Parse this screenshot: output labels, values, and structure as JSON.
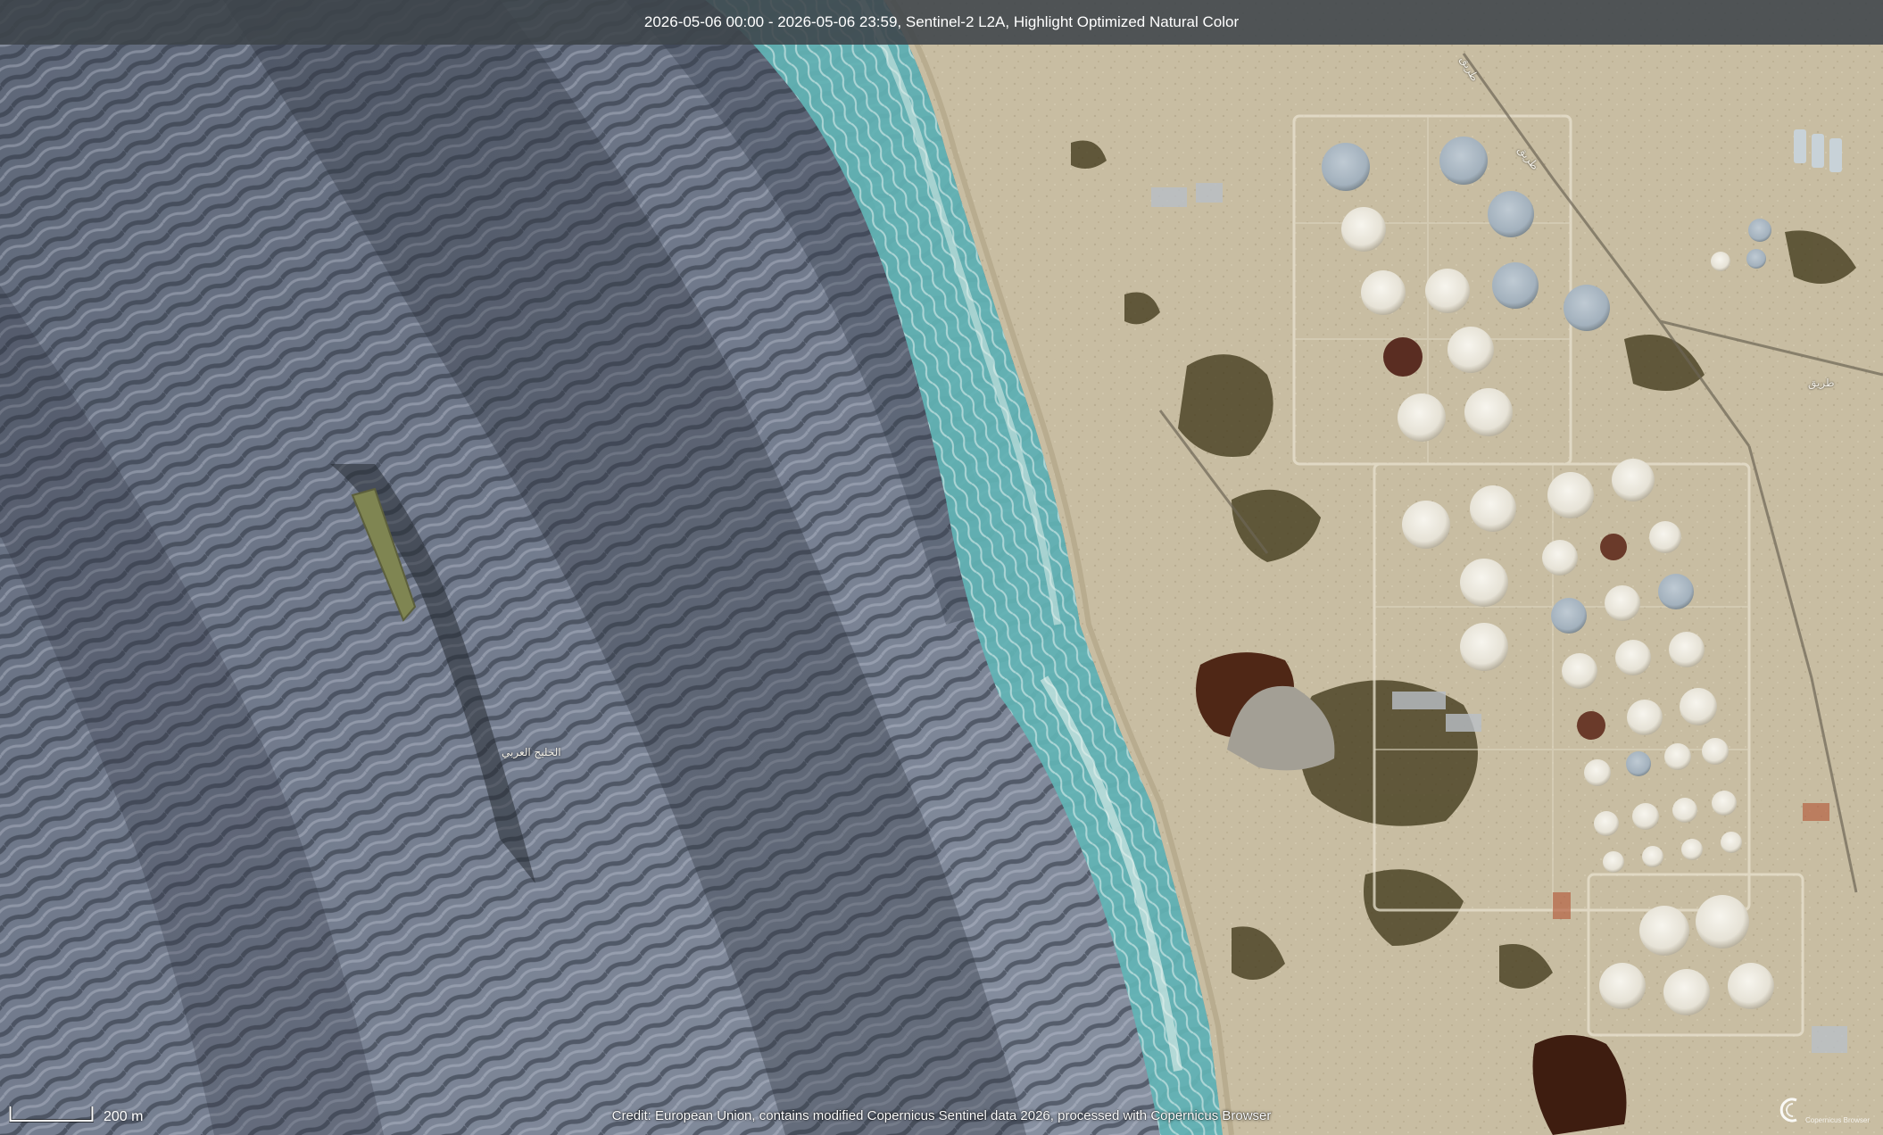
{
  "header": {
    "title": "2026-05-06 00:00 - 2026-05-06 23:59, Sentinel-2 L2A, Highlight Optimized Natural Color"
  },
  "scale": {
    "label": "200 m"
  },
  "credit": {
    "text": "Credit: European Union, contains modified Copernicus Sentinel data 2026, processed with Copernicus Browser"
  },
  "map_labels": {
    "sea_label": "الخليج العربي",
    "road_1": "طريق",
    "road_2": "طريق",
    "road_3": "طريق"
  },
  "logo": {
    "text": "Copernicus Browser"
  },
  "colors": {
    "sea_deep": "#3a4250",
    "sea_light": "#8a93a4",
    "shallow_water": "#6fc0bd",
    "sand": "#c9bea3",
    "vegetation": "#3a3416",
    "tank_white": "#e9e6dc",
    "tank_blue": "#a6b4c0",
    "pond": "#4a2414"
  }
}
